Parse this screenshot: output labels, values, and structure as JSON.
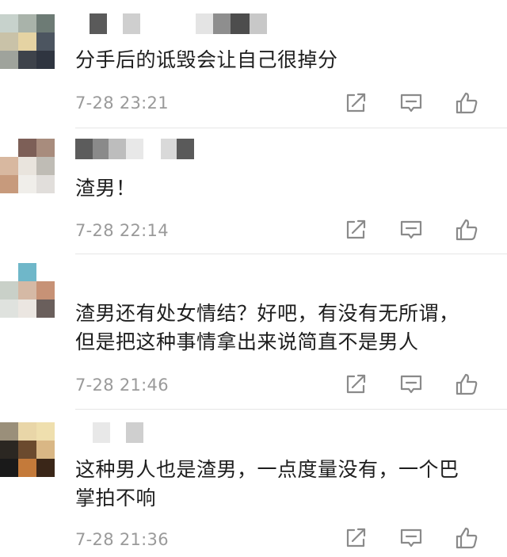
{
  "comments": [
    {
      "text": "分手后的诋毁会让自己很掉分",
      "time": "7-28 23:21"
    },
    {
      "text": "渣男！",
      "time": "7-28 22:14"
    },
    {
      "text_line1": "渣男还有处女情结？好吧，有没有无所谓，",
      "text_line2": "但是把这种事情拿出来说简直不是男人",
      "time": "7-28 21:46"
    },
    {
      "text_line1": "这种男人也是渣男，一点度量没有，一个巴",
      "text_line2": "掌拍不响",
      "time": "7-28 21:36"
    }
  ],
  "icons": {
    "share": "share-icon",
    "reply": "comment-icon",
    "like": "thumbs-up-icon"
  },
  "colors": {
    "icon": "#8a8a8a",
    "time": "#9a9a9a",
    "divider": "#e6e6e6"
  }
}
